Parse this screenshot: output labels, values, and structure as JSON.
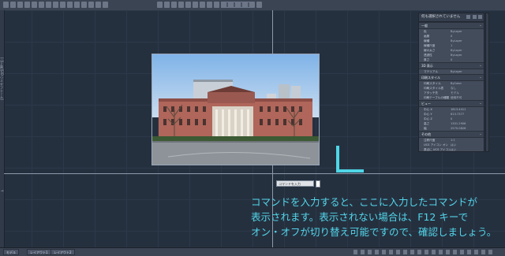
{
  "toolbar": {
    "layer_field": "0",
    "icons": [
      "tool-icon",
      "tool-icon",
      "tool-icon",
      "tool-icon",
      "tool-icon",
      "tool-icon",
      "tool-icon",
      "tool-icon",
      "tool-icon",
      "tool-icon",
      "tool-icon",
      "tool-icon",
      "tool-icon",
      "tool-icon",
      "tool-icon",
      "tool-icon",
      "tool-icon",
      "tool-icon",
      "tool-icon",
      "tool-icon",
      "tool-icon",
      "tool-icon",
      "tool-icon",
      "tool-icon",
      "tool-icon",
      "tool-icon",
      "tool-icon",
      "tool-icon",
      "tool-icon",
      "tool-icon"
    ]
  },
  "left_strip": {
    "label_top": "[-][上面][2D ワイヤフレーム]",
    "label_bottom": "Y"
  },
  "command_tooltip": {
    "text": "コマンドを入力"
  },
  "caption": {
    "line1": "コマンドを入力すると、ここに入力したコマンドが",
    "line2": "表示されます。表示されない場合は、F12 キーで",
    "line3": "オン・オフが切り替え可能ですので、確認しましょう。"
  },
  "colors": {
    "caption": "#52d6ea",
    "ucs_icon": "#4fd6e6",
    "background": "#25303f"
  },
  "properties_panel": {
    "title": "何も選択されていません",
    "sections": [
      {
        "title": "一般",
        "rows": [
          {
            "key": "色",
            "value": "ByLayer"
          },
          {
            "key": "画層",
            "value": "0"
          },
          {
            "key": "線種",
            "value": "ByLayer"
          },
          {
            "key": "線種尺度",
            "value": "1"
          },
          {
            "key": "線の太さ",
            "value": "ByLayer"
          },
          {
            "key": "透過性",
            "value": "ByLayer"
          },
          {
            "key": "厚さ",
            "value": "0"
          }
        ]
      },
      {
        "title": "3D 表示",
        "rows": [
          {
            "key": "マテリアル",
            "value": "ByLayer"
          }
        ]
      },
      {
        "title": "印刷スタイル",
        "rows": [
          {
            "key": "印刷スタイル",
            "value": "ByColor"
          },
          {
            "key": "印刷スタイル表",
            "value": "なし"
          },
          {
            "key": "アタッチ先",
            "value": "モデル"
          },
          {
            "key": "印刷テーブルの種類",
            "value": "使用不可"
          }
        ]
      },
      {
        "title": "ビュー",
        "rows": [
          {
            "key": "中心 X",
            "value": "1813.4411"
          },
          {
            "key": "中心 Y",
            "value": "613.7377"
          },
          {
            "key": "中心 Z",
            "value": "0"
          },
          {
            "key": "高さ",
            "value": "1301.2906"
          },
          {
            "key": "幅",
            "value": "2570.0826"
          }
        ]
      },
      {
        "title": "その他",
        "rows": [
          {
            "key": "注釈尺度",
            "value": "1:1"
          },
          {
            "key": "UCS アイコン オン",
            "value": "はい"
          },
          {
            "key": "原点に UCS アイコン",
            "value": "はい"
          }
        ]
      }
    ]
  },
  "status_bar": {
    "tabs": [
      "モデル",
      "レイアウト1",
      "レイアウト2"
    ]
  }
}
